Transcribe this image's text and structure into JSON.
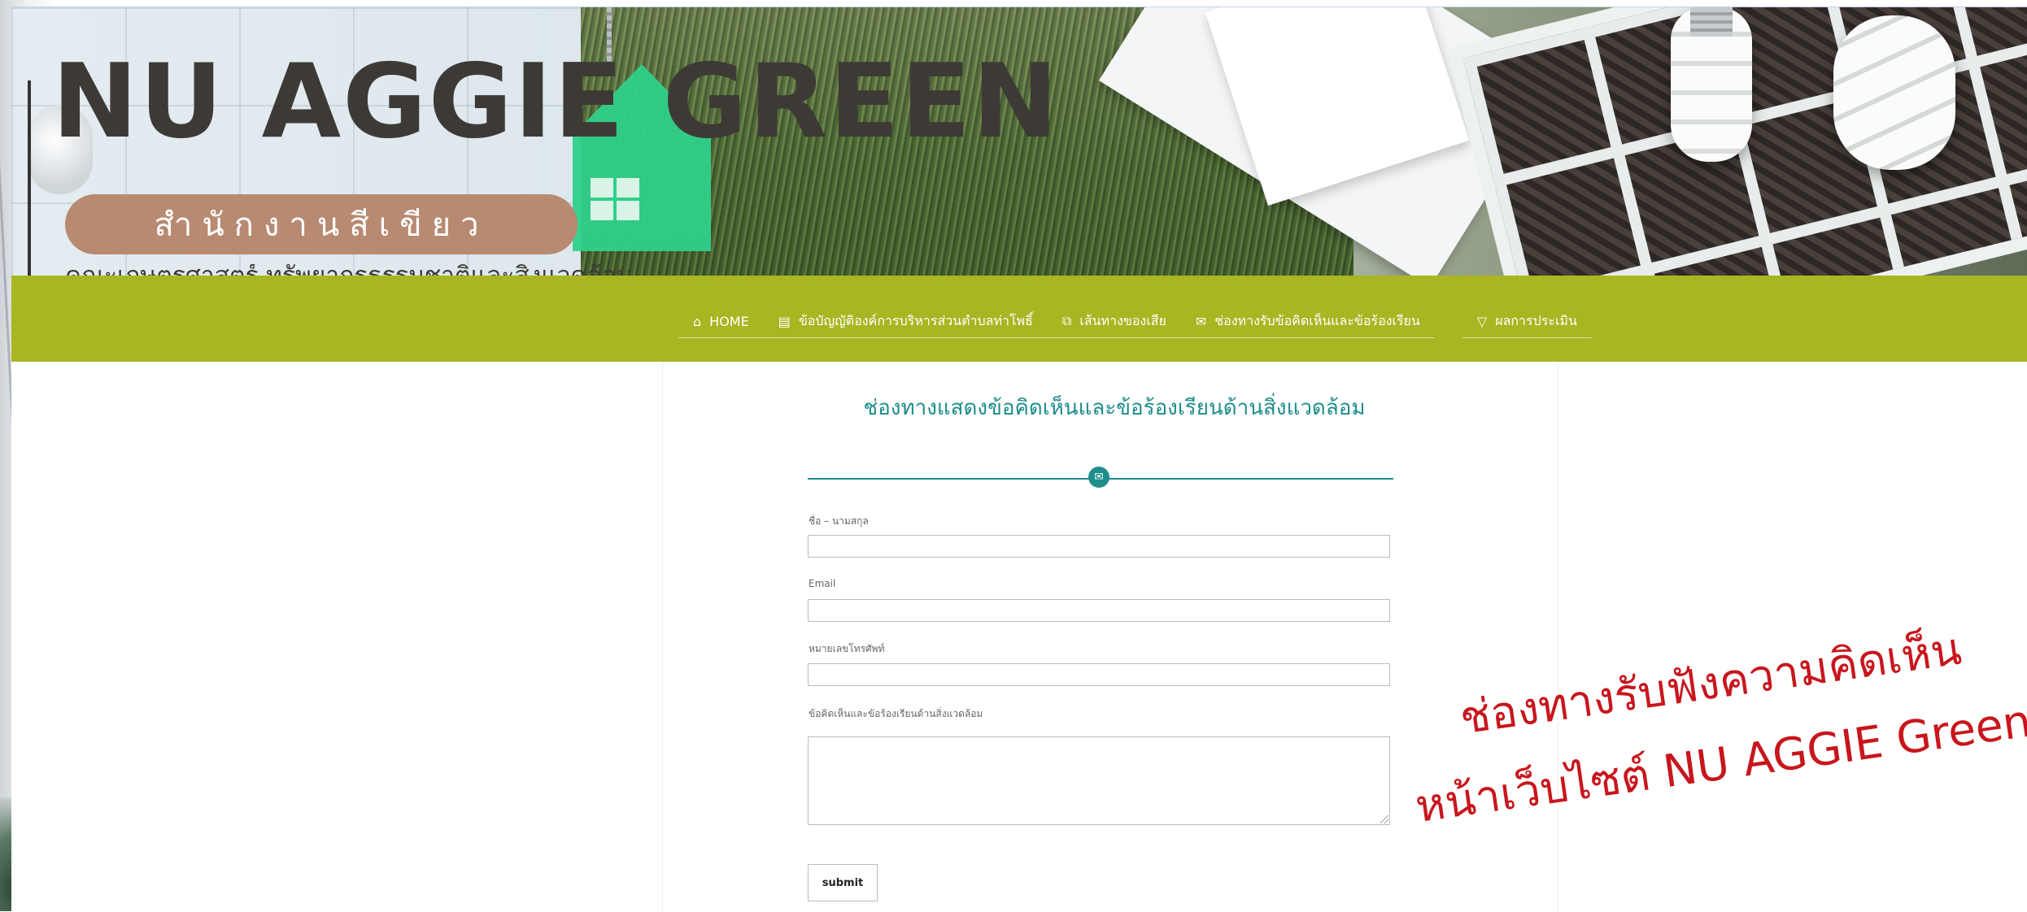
{
  "header": {
    "title": "NU AGGIE GREEN",
    "pill": "สำนักงานสีเขียว",
    "subtitle": "คณะเกษตรศาสตร์ ทรัพยากรธรรมชาติและสิ่งแวดล้อม"
  },
  "nav": {
    "items": [
      {
        "icon": "home-icon",
        "label": "HOME"
      },
      {
        "icon": "document-icon",
        "label": "ข้อบัญญัติองค์การบริหารส่วนตำบลท่าโพธิ์"
      },
      {
        "icon": "presentation-icon",
        "label": "เส้นทางของเสีย"
      },
      {
        "icon": "envelope-icon",
        "label": "ช่องทางรับข้อคิดเห็นและข้อร้องเรียน"
      },
      {
        "icon": "filter-icon",
        "label": "ผลการประเมิน"
      }
    ]
  },
  "form": {
    "title": "ช่องทางแสดงข้อคิดเห็นและข้อร้องเรียนด้านสิ่งแวดล้อม",
    "fields": [
      {
        "label": "ชื่อ – นามสกุล",
        "value": ""
      },
      {
        "label": "Email",
        "value": ""
      },
      {
        "label": "หมายเลขโทรศัพท์",
        "value": ""
      },
      {
        "label": "ข้อคิดเห็นและข้อร้องเรียนด้านสิ่งแวดล้อม",
        "value": ""
      }
    ],
    "submit": "submit"
  },
  "caption": {
    "line1": "ช่องทางรับฟังความคิดเห็น",
    "line2": "หน้าเว็บไซต์ NU AGGIE Green"
  },
  "colors": {
    "nav_bg": "#a8b622",
    "accent_teal": "#1d8e8b",
    "pill": "#b88a72",
    "caption_red": "#c8161d"
  }
}
